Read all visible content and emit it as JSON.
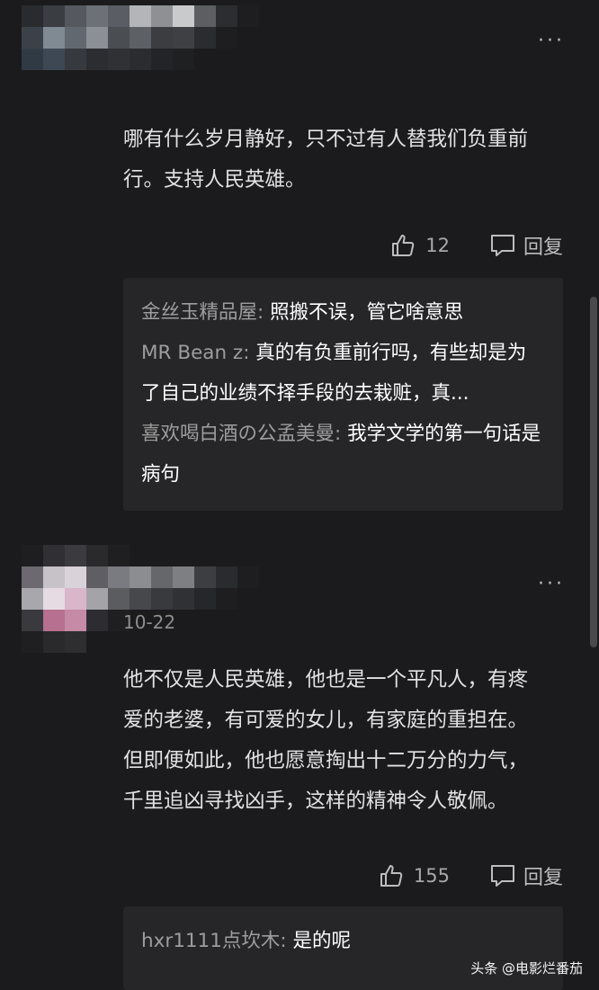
{
  "comments": [
    {
      "text": "哪有什么岁月静好，只不过有人替我们负重前\n行。支持人民英雄。",
      "likes": "12",
      "reply_label": "回复",
      "more": "···",
      "replies": [
        {
          "user": "金丝玉精品屋:",
          "text": " 照搬不误，管它啥意思"
        },
        {
          "user": "MR  Bean z:",
          "text": " 真的有负重前行吗，有些却是为了自己的业绩不择手段的去栽赃，真..."
        },
        {
          "user": "喜欢喝白酒の公孟美曼:",
          "text": " 我学文学的第一句话是病句"
        }
      ]
    },
    {
      "date": "10-22",
      "text": "他不仅是人民英雄，他也是一个平凡人，有疼\n爱的老婆，有可爱的女儿，有家庭的重担在。\n但即便如此，他也愿意掏出十二万分的力气，\n千里追凶寻找凶手，这样的精神令人敬佩。",
      "likes": "155",
      "reply_label": "回复",
      "more": "···",
      "replies": [
        {
          "user": "hxr1111点坎木:",
          "text": " 是的呢"
        }
      ]
    }
  ],
  "watermark": "头条 @电影烂番茄",
  "colors": {
    "background": "#1b1b1d",
    "reply_box": "#262628",
    "username": "#9d9d9d",
    "text": "#e2e2e2"
  }
}
